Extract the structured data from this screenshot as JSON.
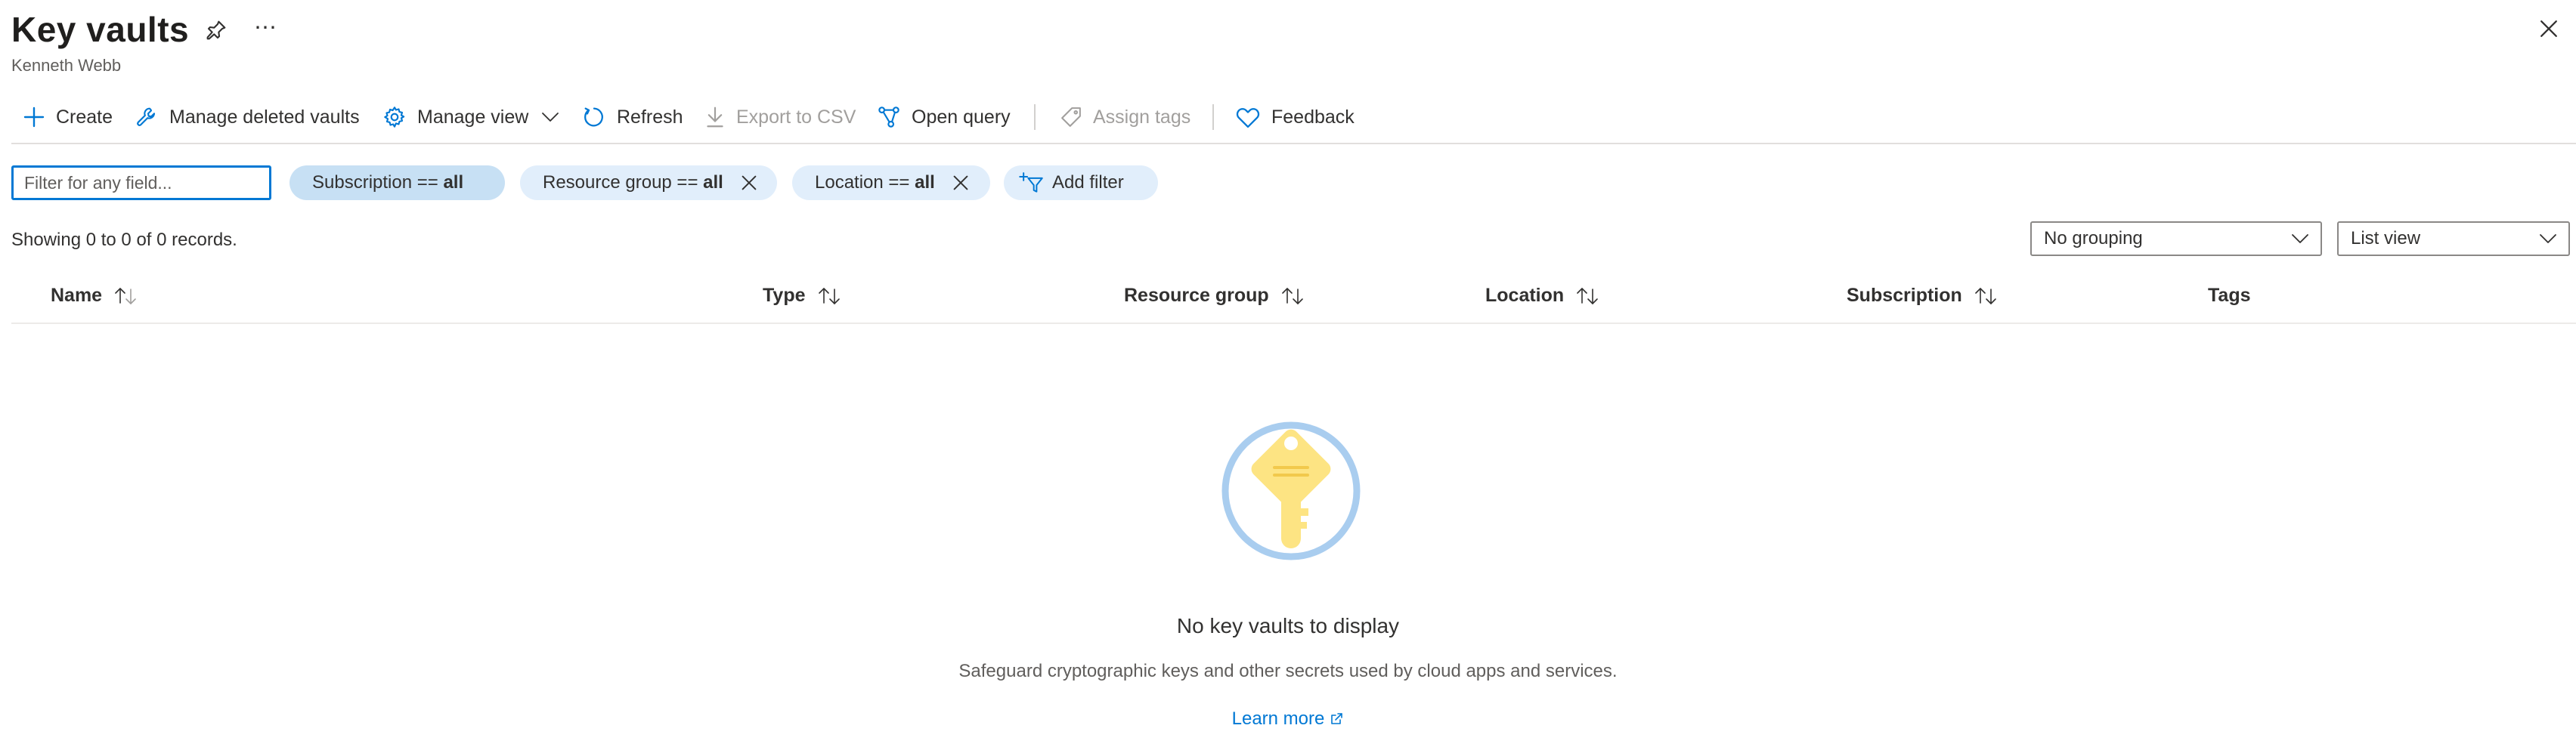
{
  "header": {
    "title": "Key vaults",
    "subtitle": "Kenneth Webb",
    "more_glyph": "⋯"
  },
  "toolbar": {
    "create": "Create",
    "manage_deleted": "Manage deleted vaults",
    "manage_view": "Manage view",
    "refresh": "Refresh",
    "export_csv": "Export to CSV",
    "open_query": "Open query",
    "assign_tags": "Assign tags",
    "feedback": "Feedback"
  },
  "filters": {
    "placeholder": "Filter for any field...",
    "subscription": {
      "label": "Subscription == ",
      "value": "all"
    },
    "resource_group": {
      "label": "Resource group == ",
      "value": "all"
    },
    "location": {
      "label": "Location == ",
      "value": "all"
    },
    "add_filter": "Add filter"
  },
  "records": "Showing 0 to 0 of 0 records.",
  "grouping": {
    "selected": "No grouping"
  },
  "view": {
    "selected": "List view"
  },
  "columns": {
    "name": "Name",
    "type": "Type",
    "resource_group": "Resource group",
    "location": "Location",
    "subscription": "Subscription",
    "tags": "Tags"
  },
  "empty_state": {
    "title": "No key vaults to display",
    "description": "Safeguard cryptographic keys and other secrets used by cloud apps and services.",
    "learn_more": "Learn more"
  },
  "colors": {
    "accent": "#0078d4",
    "pill_bg": "#e1eefb",
    "pill_active_bg": "#c7e0f4",
    "key_yellow": "#fde483",
    "ring_blue": "#a9cdef"
  },
  "icons": {
    "pin": "pin-icon",
    "more": "more-icon",
    "close": "close-icon",
    "create": "plus-icon",
    "manage_deleted": "wrench-icon",
    "manage_view": "gear-icon",
    "refresh": "refresh-icon",
    "export": "download-icon",
    "open_query": "query-icon",
    "assign_tags": "tag-icon",
    "feedback": "heart-icon",
    "add_filter": "filter-add-icon",
    "illustration": "key-vault-illustration"
  }
}
